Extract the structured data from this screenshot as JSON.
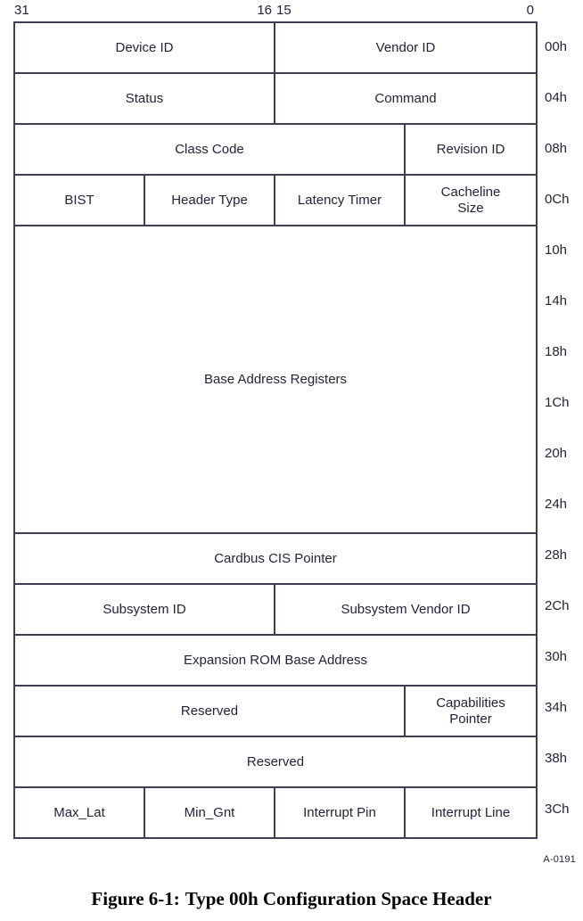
{
  "figure": {
    "id_code": "A-0191",
    "caption_label": "Figure 6-1:",
    "caption_title": "Type 00h Configuration Space Header"
  },
  "bit_ruler": {
    "left_half": {
      "start": "31",
      "end": "16"
    },
    "right_half": {
      "start": "15",
      "end": "0"
    }
  },
  "offsets": [
    "00h",
    "04h",
    "08h",
    "0Ch",
    "10h",
    "14h",
    "18h",
    "1Ch",
    "20h",
    "24h",
    "28h",
    "2Ch",
    "30h",
    "34h",
    "38h",
    "3Ch"
  ],
  "rows": [
    {
      "offset": "00h",
      "fields": [
        {
          "label": "Device ID",
          "width": "half"
        },
        {
          "label": "Vendor ID",
          "width": "half"
        }
      ]
    },
    {
      "offset": "04h",
      "fields": [
        {
          "label": "Status",
          "width": "half"
        },
        {
          "label": "Command",
          "width": "half"
        }
      ]
    },
    {
      "offset": "08h",
      "fields": [
        {
          "label": "Class Code",
          "width": "three-quarter"
        },
        {
          "label": "Revision ID",
          "width": "quarter"
        }
      ]
    },
    {
      "offset": "0Ch",
      "fields": [
        {
          "label": "BIST",
          "width": "quarter"
        },
        {
          "label": "Header Type",
          "width": "quarter"
        },
        {
          "label": "Latency Timer",
          "width": "quarter"
        },
        {
          "label": "Cacheline Size",
          "width": "quarter"
        }
      ]
    },
    {
      "offset_span": [
        "10h",
        "14h",
        "18h",
        "1Ch",
        "20h",
        "24h"
      ],
      "fields": [
        {
          "label": "Base Address Registers",
          "width": "full"
        }
      ]
    },
    {
      "offset": "28h",
      "fields": [
        {
          "label": "Cardbus CIS Pointer",
          "width": "full"
        }
      ]
    },
    {
      "offset": "2Ch",
      "fields": [
        {
          "label": "Subsystem ID",
          "width": "half"
        },
        {
          "label": "Subsystem Vendor ID",
          "width": "half"
        }
      ]
    },
    {
      "offset": "30h",
      "fields": [
        {
          "label": "Expansion ROM Base Address",
          "width": "full"
        }
      ]
    },
    {
      "offset": "34h",
      "fields": [
        {
          "label": "Reserved",
          "width": "three-quarter"
        },
        {
          "label": "Capabilities Pointer",
          "width": "quarter"
        }
      ]
    },
    {
      "offset": "38h",
      "fields": [
        {
          "label": "Reserved",
          "width": "full"
        }
      ]
    },
    {
      "offset": "3Ch",
      "fields": [
        {
          "label": "Max_Lat",
          "width": "quarter"
        },
        {
          "label": "Min_Gnt",
          "width": "quarter"
        },
        {
          "label": "Interrupt Pin",
          "width": "quarter"
        },
        {
          "label": "Interrupt Line",
          "width": "quarter"
        }
      ]
    }
  ],
  "colors": {
    "border": "#3c3f4f",
    "text": "#22243a",
    "background": "#ffffff"
  }
}
